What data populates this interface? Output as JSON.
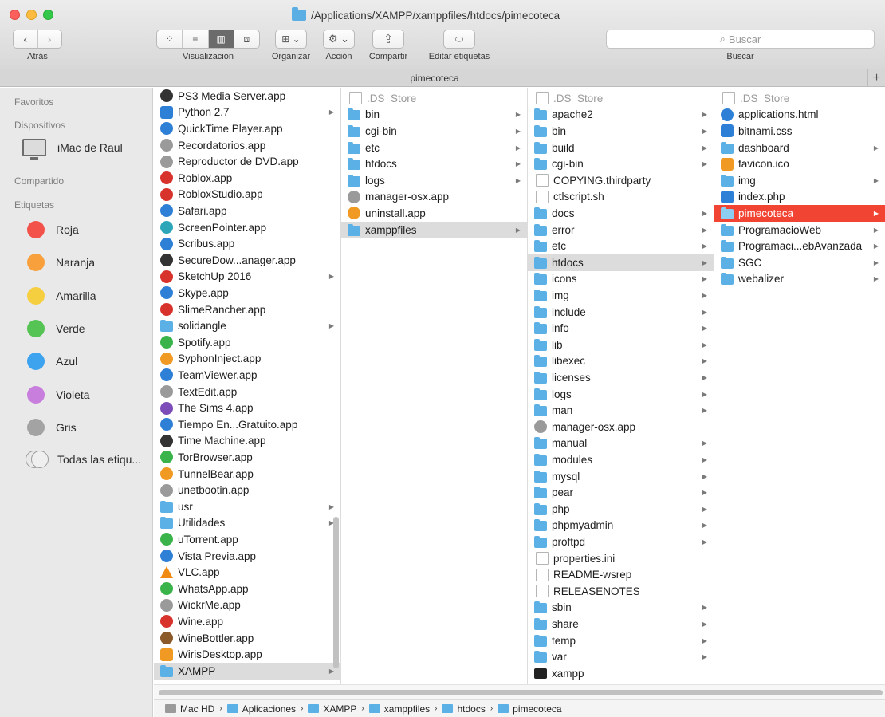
{
  "window": {
    "title": "/Applications/XAMPP/xamppfiles/htdocs/pimecoteca",
    "tab_title": "pimecoteca",
    "tab_add": "+"
  },
  "toolbar": {
    "back_glyph": "‹",
    "forward_glyph": "›",
    "back_label": "Atrás",
    "view_label": "Visualización",
    "arrange_label": "Organizar",
    "action_label": "Acción",
    "share_label": "Compartir",
    "tags_label": "Editar etiquetas",
    "search_placeholder": "Buscar",
    "search_label": "Buscar"
  },
  "sidebar": {
    "favorites_header": "Favoritos",
    "devices_header": "Dispositivos",
    "device_name": "iMac de Raul",
    "shared_header": "Compartido",
    "tags_header": "Etiquetas",
    "tags": [
      {
        "label": "Roja",
        "color": "#f2524a"
      },
      {
        "label": "Naranja",
        "color": "#f7a03c"
      },
      {
        "label": "Amarilla",
        "color": "#f5cf3f"
      },
      {
        "label": "Verde",
        "color": "#55c454"
      },
      {
        "label": "Azul",
        "color": "#3ea3ee"
      },
      {
        "label": "Violeta",
        "color": "#c77edc"
      },
      {
        "label": "Gris",
        "color": "#a3a3a3"
      }
    ],
    "all_tags_label": "Todas las etiqu..."
  },
  "column1": [
    {
      "label": "PS3 Media Server.app",
      "icon": "app",
      "color": "c-dark",
      "dir": false
    },
    {
      "label": "Python 2.7",
      "icon": "folder-app",
      "color": "c-blue",
      "dir": true
    },
    {
      "label": "QuickTime Player.app",
      "icon": "app",
      "color": "c-blue",
      "dir": false
    },
    {
      "label": "Recordatorios.app",
      "icon": "app",
      "color": "c-gray",
      "dir": false
    },
    {
      "label": "Reproductor de DVD.app",
      "icon": "app",
      "color": "c-gray",
      "dir": false
    },
    {
      "label": "Roblox.app",
      "icon": "app",
      "color": "c-red",
      "dir": false
    },
    {
      "label": "RobloxStudio.app",
      "icon": "app",
      "color": "c-red",
      "dir": false
    },
    {
      "label": "Safari.app",
      "icon": "app",
      "color": "c-blue",
      "dir": false
    },
    {
      "label": "ScreenPointer.app",
      "icon": "app",
      "color": "c-teal",
      "dir": false
    },
    {
      "label": "Scribus.app",
      "icon": "app",
      "color": "c-blue",
      "dir": false
    },
    {
      "label": "SecureDow...anager.app",
      "icon": "app",
      "color": "c-dark",
      "dir": false
    },
    {
      "label": "SketchUp 2016",
      "icon": "app",
      "color": "c-red",
      "dir": true
    },
    {
      "label": "Skype.app",
      "icon": "app",
      "color": "c-blue",
      "dir": false
    },
    {
      "label": "SlimeRancher.app",
      "icon": "app",
      "color": "c-red",
      "dir": false
    },
    {
      "label": "solidangle",
      "icon": "folder",
      "color": "",
      "dir": true
    },
    {
      "label": "Spotify.app",
      "icon": "app",
      "color": "c-green",
      "dir": false
    },
    {
      "label": "SyphonInject.app",
      "icon": "app",
      "color": "c-orange",
      "dir": false
    },
    {
      "label": "TeamViewer.app",
      "icon": "app",
      "color": "c-blue",
      "dir": false
    },
    {
      "label": "TextEdit.app",
      "icon": "app",
      "color": "c-gray",
      "dir": false
    },
    {
      "label": "The Sims 4.app",
      "icon": "app",
      "color": "c-purple",
      "dir": false
    },
    {
      "label": "Tiempo En...Gratuito.app",
      "icon": "app",
      "color": "c-blue",
      "dir": false
    },
    {
      "label": "Time Machine.app",
      "icon": "app",
      "color": "c-dark",
      "dir": false
    },
    {
      "label": "TorBrowser.app",
      "icon": "app",
      "color": "c-green",
      "dir": false
    },
    {
      "label": "TunnelBear.app",
      "icon": "app",
      "color": "c-orange",
      "dir": false
    },
    {
      "label": "unetbootin.app",
      "icon": "app",
      "color": "c-gray",
      "dir": false
    },
    {
      "label": "usr",
      "icon": "folder",
      "color": "",
      "dir": true
    },
    {
      "label": "Utilidades",
      "icon": "folder",
      "color": "",
      "dir": true
    },
    {
      "label": "uTorrent.app",
      "icon": "app",
      "color": "c-green",
      "dir": false
    },
    {
      "label": "Vista Previa.app",
      "icon": "app",
      "color": "c-blue",
      "dir": false
    },
    {
      "label": "VLC.app",
      "icon": "cone",
      "color": "",
      "dir": false
    },
    {
      "label": "WhatsApp.app",
      "icon": "app",
      "color": "c-green",
      "dir": false
    },
    {
      "label": "WickrMe.app",
      "icon": "app",
      "color": "c-gray",
      "dir": false
    },
    {
      "label": "Wine.app",
      "icon": "app",
      "color": "c-red",
      "dir": false
    },
    {
      "label": "WineBottler.app",
      "icon": "app",
      "color": "c-brown",
      "dir": false
    },
    {
      "label": "WirisDesktop.app",
      "icon": "app-sq",
      "color": "c-orange",
      "dir": false
    },
    {
      "label": "XAMPP",
      "icon": "folder",
      "color": "",
      "dir": true,
      "state": "hl"
    }
  ],
  "column2": [
    {
      "label": ".DS_Store",
      "icon": "doc",
      "dir": false,
      "state": "dim"
    },
    {
      "label": "bin",
      "icon": "folder",
      "dir": true
    },
    {
      "label": "cgi-bin",
      "icon": "folder",
      "dir": true
    },
    {
      "label": "etc",
      "icon": "folder",
      "dir": true
    },
    {
      "label": "htdocs",
      "icon": "folder",
      "dir": true
    },
    {
      "label": "logs",
      "icon": "folder",
      "dir": true
    },
    {
      "label": "manager-osx.app",
      "icon": "app",
      "color": "c-gray",
      "dir": false
    },
    {
      "label": "uninstall.app",
      "icon": "app",
      "color": "c-orange",
      "dir": false
    },
    {
      "label": "xamppfiles",
      "icon": "folder",
      "dir": true,
      "state": "hl"
    }
  ],
  "column3": [
    {
      "label": ".DS_Store",
      "icon": "doc",
      "dir": false,
      "state": "dim"
    },
    {
      "label": "apache2",
      "icon": "folder",
      "dir": true
    },
    {
      "label": "bin",
      "icon": "folder",
      "dir": true
    },
    {
      "label": "build",
      "icon": "folder",
      "dir": true
    },
    {
      "label": "cgi-bin",
      "icon": "folder",
      "dir": true
    },
    {
      "label": "COPYING.thirdparty",
      "icon": "doc",
      "dir": false
    },
    {
      "label": "ctlscript.sh",
      "icon": "doc",
      "dir": false
    },
    {
      "label": "docs",
      "icon": "folder",
      "dir": true
    },
    {
      "label": "error",
      "icon": "folder",
      "dir": true
    },
    {
      "label": "etc",
      "icon": "folder",
      "dir": true
    },
    {
      "label": "htdocs",
      "icon": "folder",
      "dir": true,
      "state": "hl"
    },
    {
      "label": "icons",
      "icon": "folder",
      "dir": true
    },
    {
      "label": "img",
      "icon": "folder",
      "dir": true
    },
    {
      "label": "include",
      "icon": "folder",
      "dir": true
    },
    {
      "label": "info",
      "icon": "folder",
      "dir": true
    },
    {
      "label": "lib",
      "icon": "folder",
      "dir": true
    },
    {
      "label": "libexec",
      "icon": "folder",
      "dir": true
    },
    {
      "label": "licenses",
      "icon": "folder",
      "dir": true
    },
    {
      "label": "logs",
      "icon": "folder",
      "dir": true
    },
    {
      "label": "man",
      "icon": "folder",
      "dir": true
    },
    {
      "label": "manager-osx.app",
      "icon": "app",
      "color": "c-gray",
      "dir": false
    },
    {
      "label": "manual",
      "icon": "folder",
      "dir": true
    },
    {
      "label": "modules",
      "icon": "folder",
      "dir": true
    },
    {
      "label": "mysql",
      "icon": "folder",
      "dir": true
    },
    {
      "label": "pear",
      "icon": "folder",
      "dir": true
    },
    {
      "label": "php",
      "icon": "folder",
      "dir": true
    },
    {
      "label": "phpmyadmin",
      "icon": "folder",
      "dir": true
    },
    {
      "label": "proftpd",
      "icon": "folder",
      "dir": true
    },
    {
      "label": "properties.ini",
      "icon": "doc",
      "dir": false
    },
    {
      "label": "README-wsrep",
      "icon": "doc",
      "dir": false
    },
    {
      "label": "RELEASENOTES",
      "icon": "doc",
      "dir": false
    },
    {
      "label": "sbin",
      "icon": "folder",
      "dir": true
    },
    {
      "label": "share",
      "icon": "folder",
      "dir": true
    },
    {
      "label": "temp",
      "icon": "folder",
      "dir": true
    },
    {
      "label": "var",
      "icon": "folder",
      "dir": true
    },
    {
      "label": "xampp",
      "icon": "term",
      "dir": false
    }
  ],
  "column4": [
    {
      "label": ".DS_Store",
      "icon": "doc",
      "dir": false,
      "state": "dim"
    },
    {
      "label": "applications.html",
      "icon": "app",
      "color": "c-blue",
      "dir": false
    },
    {
      "label": "bitnami.css",
      "icon": "app-sq",
      "color": "c-blue",
      "dir": false
    },
    {
      "label": "dashboard",
      "icon": "folder",
      "dir": true
    },
    {
      "label": "favicon.ico",
      "icon": "app-sq",
      "color": "c-orange",
      "dir": false
    },
    {
      "label": "img",
      "icon": "folder",
      "dir": true
    },
    {
      "label": "index.php",
      "icon": "app-sq",
      "color": "c-blue",
      "dir": false
    },
    {
      "label": "pimecoteca",
      "icon": "folder",
      "dir": true,
      "state": "sel"
    },
    {
      "label": "ProgramacioWeb",
      "icon": "folder",
      "dir": true
    },
    {
      "label": "Programaci...ebAvanzada",
      "icon": "folder",
      "dir": true
    },
    {
      "label": "SGC",
      "icon": "folder",
      "dir": true
    },
    {
      "label": "webalizer",
      "icon": "folder",
      "dir": true
    }
  ],
  "pathbar": [
    {
      "label": "Mac HD",
      "icon": "disk"
    },
    {
      "label": "Aplicaciones",
      "icon": "folder"
    },
    {
      "label": "XAMPP",
      "icon": "folder"
    },
    {
      "label": "xamppfiles",
      "icon": "folder"
    },
    {
      "label": "htdocs",
      "icon": "folder"
    },
    {
      "label": "pimecoteca",
      "icon": "folder"
    }
  ]
}
